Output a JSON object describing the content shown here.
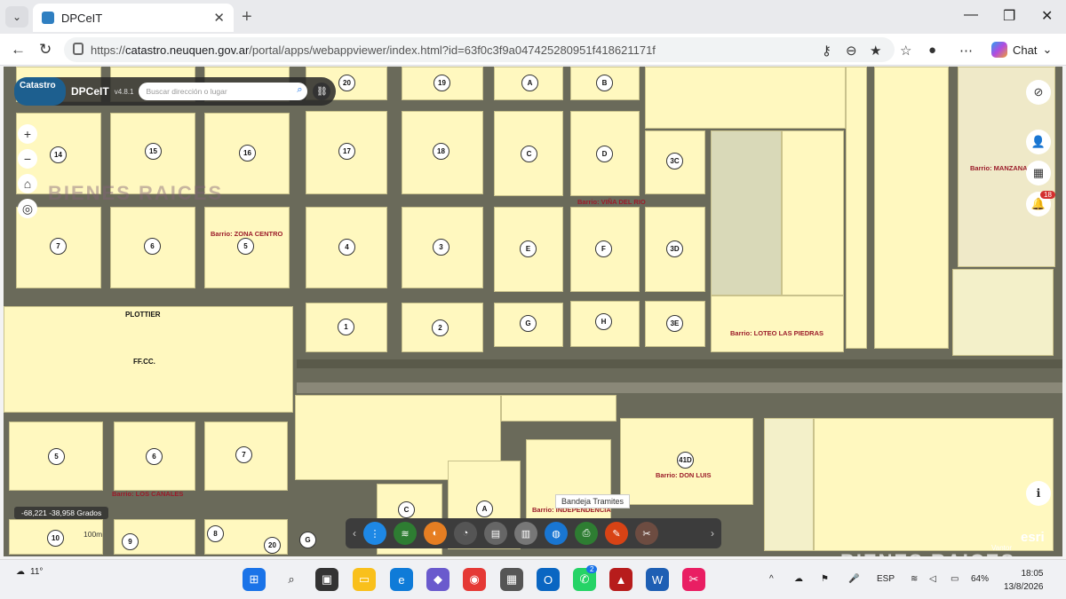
{
  "browser": {
    "tab_title": "DPCeIT",
    "url_prefix": "https://",
    "url_host": "catastro.neuquen.gov.ar",
    "url_path": "/portal/apps/webappviewer/index.html?id=63f0c3f9a047425280951f418621171f",
    "chat_label": "Chat"
  },
  "app": {
    "logo_text": "Catastro",
    "title": "DPCeIT",
    "version": "v4.8.1",
    "search_placeholder": "Buscar dirección o lugar",
    "coords": "-68,221 -38,958 Grados",
    "scale": "100m",
    "bandeja": "Bandeja Tramites",
    "notification_count": "18",
    "credit": "Vantor",
    "esri": "esri"
  },
  "blocks": [
    "20",
    "19",
    "A",
    "B",
    "15",
    "16",
    "17",
    "18",
    "C",
    "D",
    "3C",
    "14",
    "7",
    "6",
    "5",
    "4",
    "3",
    "E",
    "F",
    "3D",
    "1",
    "2",
    "G",
    "H",
    "3E",
    "5",
    "6",
    "7",
    "41D",
    "C",
    "A",
    "10",
    "9",
    "8",
    "20",
    "G"
  ],
  "barrios": [
    "Barrio: ZONA CENTRO",
    "Barrio: VIÑA DEL RIO",
    "Barrio: MANZANA",
    "Barrio: LOTEO LAS PIEDRAS",
    "Barrio: LOS CANALES",
    "Barrio: DON LUIS",
    "Barrio: INDEPENDENCIA"
  ],
  "labels": {
    "plottier": "PLOTTIER",
    "ffcc": "FF.CC."
  },
  "watermark": "BIENES RAICES",
  "taskbar": {
    "temp": "11°",
    "lang": "ESP",
    "battery": "64%",
    "time": "18:05",
    "date": "13/8/2026",
    "whatsapp_badge": "2"
  }
}
